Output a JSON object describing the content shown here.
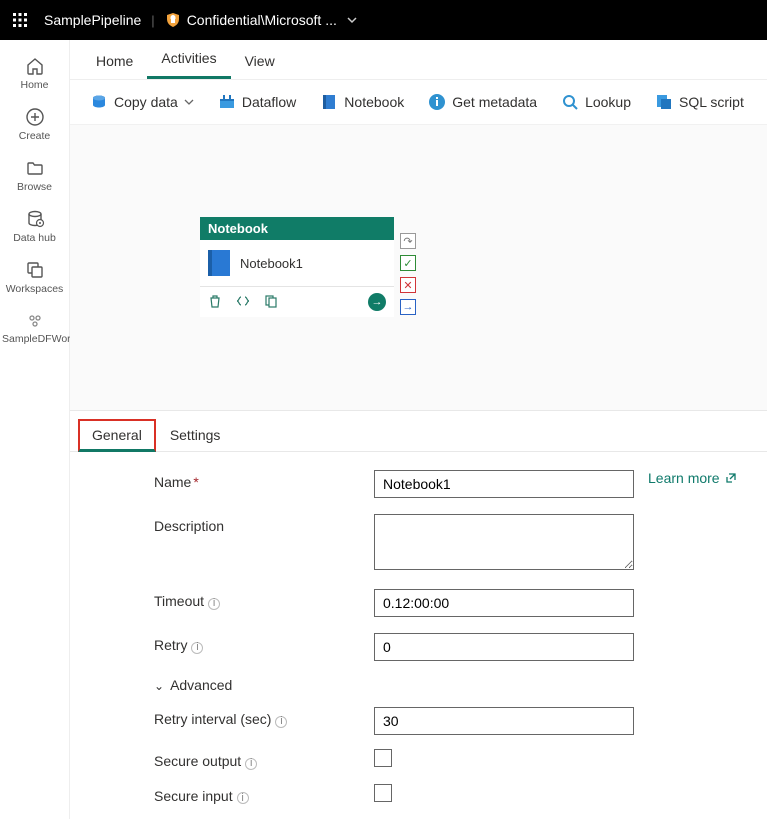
{
  "topbar": {
    "pipeline_name": "SamplePipeline",
    "sensitivity_label": "Confidential\\Microsoft ..."
  },
  "sidebar": {
    "items": [
      {
        "label": "Home"
      },
      {
        "label": "Create"
      },
      {
        "label": "Browse"
      },
      {
        "label": "Data hub"
      },
      {
        "label": "Workspaces"
      },
      {
        "label": "SampleDFWorkspace"
      }
    ]
  },
  "main_tabs": {
    "items": [
      {
        "label": "Home"
      },
      {
        "label": "Activities"
      },
      {
        "label": "View"
      }
    ]
  },
  "toolbar": {
    "copy_data": "Copy data",
    "dataflow": "Dataflow",
    "notebook": "Notebook",
    "get_metadata": "Get metadata",
    "lookup": "Lookup",
    "sql_script": "SQL script"
  },
  "node": {
    "header": "Notebook",
    "name": "Notebook1"
  },
  "panel_tabs": {
    "general": "General",
    "settings": "Settings"
  },
  "form": {
    "name_label": "Name",
    "name_value": "Notebook1",
    "learn_more": "Learn more",
    "description_label": "Description",
    "description_value": "",
    "timeout_label": "Timeout",
    "timeout_value": "0.12:00:00",
    "retry_label": "Retry",
    "retry_value": "0",
    "advanced_label": "Advanced",
    "retry_interval_label": "Retry interval (sec)",
    "retry_interval_value": "30",
    "secure_output_label": "Secure output",
    "secure_input_label": "Secure input"
  }
}
